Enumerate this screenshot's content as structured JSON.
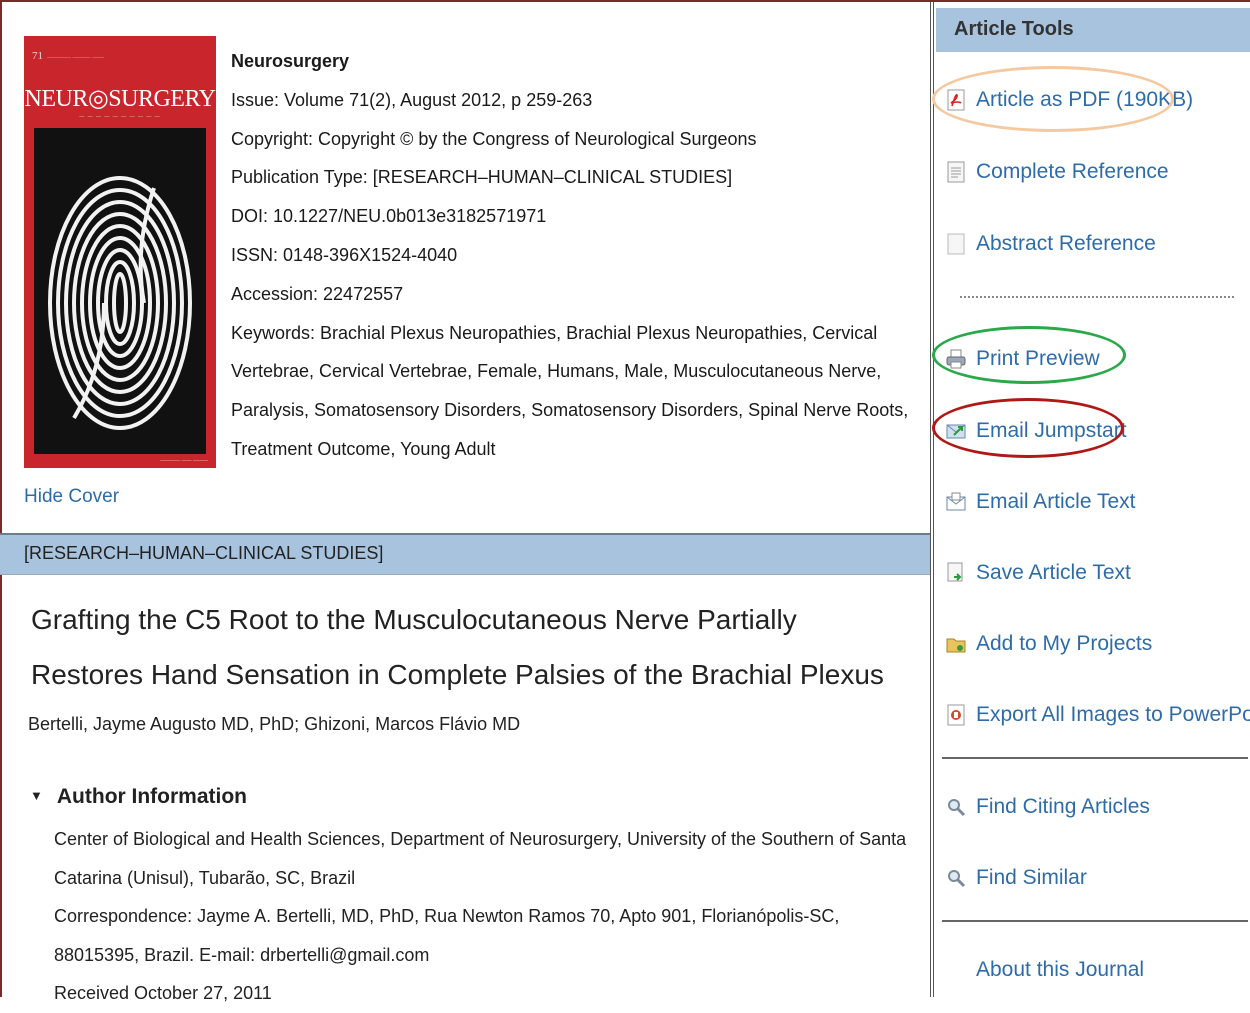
{
  "journal": {
    "cover": {
      "volume_mark": "71",
      "title": "NEUR◎SURGERY"
    },
    "name": "Neurosurgery",
    "issue": "Issue: Volume 71(2), August 2012, p 259-263",
    "copyright": "Copyright: Copyright © by the Congress of Neurological Surgeons",
    "publication_type": "Publication Type: [RESEARCH–HUMAN–CLINICAL STUDIES]",
    "doi": "DOI: 10.1227/NEU.0b013e3182571971",
    "issn": "ISSN: 0148-396X1524-4040",
    "accession": "Accession: 22472557",
    "keywords": "Keywords: Brachial Plexus Neuropathies, Brachial Plexus Neuropathies, Cervical Vertebrae, Cervical Vertebrae, Female, Humans, Male, Musculocutaneous Nerve, Paralysis, Somatosensory Disorders, Somatosensory Disorders, Spinal Nerve Roots, Treatment Outcome, Young Adult"
  },
  "hide_cover_label": "Hide Cover",
  "section_label": "[RESEARCH–HUMAN–CLINICAL STUDIES]",
  "article": {
    "title": "Grafting the C5 Root to the Musculocutaneous Nerve Partially Restores Hand Sensation in Complete Palsies of the Brachial Plexus",
    "authors": "Bertelli, Jayme Augusto MD, PhD; Ghizoni, Marcos Flávio MD",
    "author_info_heading": "Author Information",
    "affiliation": "Center of Biological and Health Sciences, Department of Neurosurgery, University of the Southern of Santa Catarina (Unisul), Tubarão, SC, Brazil",
    "correspondence": "Correspondence: Jayme A. Bertelli, MD, PhD, Rua Newton Ramos 70, Apto 901, Florianópolis-SC, 88015395, Brazil. E-mail: drbertelli@gmail.com",
    "received": "Received October 27, 2011"
  },
  "tools": {
    "heading": "Article Tools",
    "pdf": "Article as PDF (190KB)",
    "complete_reference": "Complete Reference",
    "abstract_reference": "Abstract Reference",
    "print_preview": "Print Preview",
    "email_jumpstart": "Email Jumpstart",
    "email_article_text": "Email Article Text",
    "save_article_text": "Save Article Text",
    "add_to_projects": "Add to My Projects",
    "export_images": "Export All Images to PowerPoint",
    "find_citing": "Find Citing Articles",
    "find_similar": "Find Similar",
    "about_journal": "About this Journal"
  },
  "colors": {
    "link": "#2e6ca8",
    "header_bar": "#a8c3de",
    "cover_red": "#c8262c",
    "highlight_orange": "#f5c9a0",
    "highlight_green": "#2aa84a",
    "highlight_red": "#b01818"
  },
  "icons": {
    "pdf": "pdf-icon",
    "reference": "document-icon",
    "print": "printer-icon",
    "email_jumpstart": "email-jumpstart-icon",
    "email": "envelope-icon",
    "save": "save-icon",
    "folder": "folder-icon",
    "powerpoint": "powerpoint-icon",
    "search": "magnifier-icon"
  }
}
